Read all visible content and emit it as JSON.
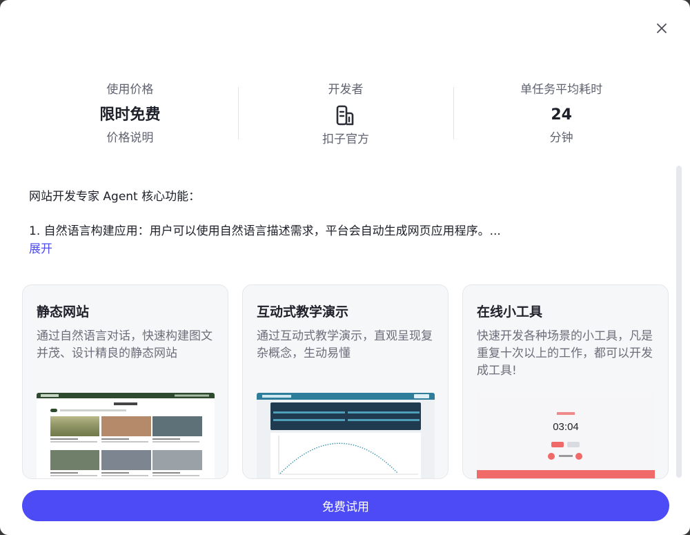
{
  "stats": [
    {
      "label": "使用价格",
      "value": "限时免费",
      "sub": "价格说明"
    },
    {
      "label": "开发者",
      "icon": "building-icon",
      "sub": "扣子官方"
    },
    {
      "label": "单任务平均耗时",
      "value": "24",
      "sub": "分钟"
    }
  ],
  "description": {
    "heading": "网站开发专家 Agent 核心功能：",
    "item1": "1. 自然语言构建应用：用户可以使用自然语言描述需求，平台会自动生成网页应用程序。...",
    "expand": "展开"
  },
  "cards": [
    {
      "title": "静态网站",
      "text": "通过自然语言对话，快速构建图文并茂、设计精良的静态网站",
      "preview": "static-site-preview"
    },
    {
      "title": "互动式教学演示",
      "text": "通过互动式教学演示，直观呈现复杂概念，生动易懂",
      "preview": "teaching-demo-preview"
    },
    {
      "title": "在线小工具",
      "text": "快速开发各种场景的小工具，凡是重复十次以上的工作，都可以开发成工具!",
      "preview": "timer-tool-preview",
      "timer": "03:04"
    }
  ],
  "cta": "免费试用",
  "colors": {
    "accent": "#4d4bf5",
    "link": "#4d4cf2",
    "timer_red": "#f06a6a"
  }
}
